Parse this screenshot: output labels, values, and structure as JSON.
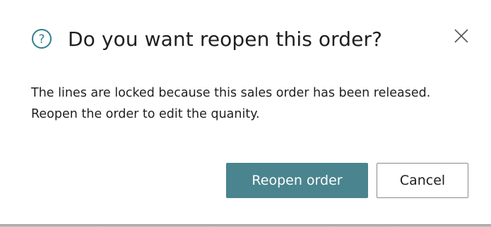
{
  "dialog": {
    "title": "Do you want reopen this order?",
    "icon": "question-circle-icon",
    "close_icon": "close-icon",
    "message_lines": [
      "The lines are locked because this sales order has been released.",
      "Reopen the order to edit the quanity."
    ],
    "primary_button_label": "Reopen order",
    "secondary_button_label": "Cancel"
  },
  "colors": {
    "accent": "#4a848f",
    "icon": "#2f7f8f",
    "text": "#212121",
    "button_border": "#8a8a8a"
  }
}
